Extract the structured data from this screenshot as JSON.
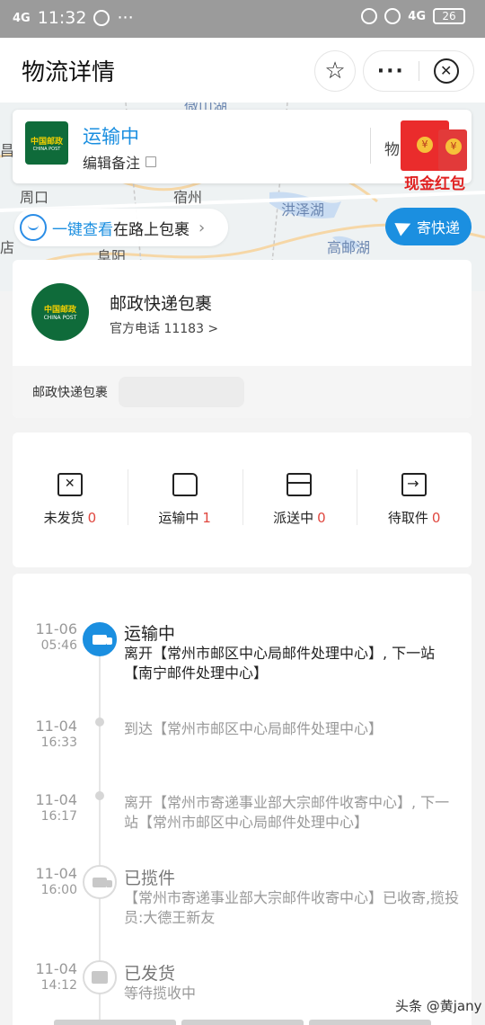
{
  "statusbar": {
    "network": "4G",
    "time": "11:32",
    "notif": "···",
    "network_right": "4G",
    "battery": "26"
  },
  "header": {
    "title": "物流详情",
    "star_icon": "star-icon",
    "more_label": "···",
    "close_icon": "close-icon"
  },
  "map": {
    "labels": [
      "昌",
      "周口",
      "宿州",
      "洪泽湖",
      "阜阳",
      "高邮湖",
      "店",
      "阳",
      "微山湖"
    ]
  },
  "status_card": {
    "status": "运输中",
    "note": "编辑备注",
    "right_text": "物",
    "logo_top": "中国邮政",
    "logo_bottom": "CHINA POST"
  },
  "red_envelope": {
    "label": "现金红包",
    "coin": "¥"
  },
  "one_click": {
    "link": "一键查看",
    "text": "在路上包裹",
    "chevron": "›"
  },
  "send_button": {
    "label": "寄快递"
  },
  "company": {
    "name": "邮政快递包裹",
    "phone": "官方电话 11183 >",
    "package_label": "邮政快递包裹",
    "logo_top": "中国邮政",
    "logo_bottom": "CHINA POST"
  },
  "counts": [
    {
      "label": "未发货",
      "count": "0"
    },
    {
      "label": "运输中",
      "count": "1"
    },
    {
      "label": "派送中",
      "count": "0"
    },
    {
      "label": "待取件",
      "count": "0"
    }
  ],
  "timeline": [
    {
      "date": "11-06",
      "time": "05:46",
      "title": "运输中",
      "desc": "离开【常州市邮区中心局邮件处理中心】, 下一站【南宁邮件处理中心】"
    },
    {
      "date": "11-04",
      "time": "16:33",
      "title": "",
      "desc": "到达【常州市邮区中心局邮件处理中心】"
    },
    {
      "date": "11-04",
      "time": "16:17",
      "title": "",
      "desc": "离开【常州市寄递事业部大宗邮件收寄中心】, 下一站【常州市邮区中心局邮件处理中心】"
    },
    {
      "date": "11-04",
      "time": "16:00",
      "title": "已揽件",
      "desc": "【常州市寄递事业部大宗邮件收寄中心】已收寄,揽投员:大德王新友"
    },
    {
      "date": "11-04",
      "time": "14:12",
      "title": "已发货",
      "desc": "等待揽收中"
    }
  ],
  "watermark": {
    "text": "头条 @黄jany"
  },
  "colors": {
    "accent": "#1b8fe0",
    "brand_green": "#0f6b3a",
    "count_red": "#e0473f"
  }
}
